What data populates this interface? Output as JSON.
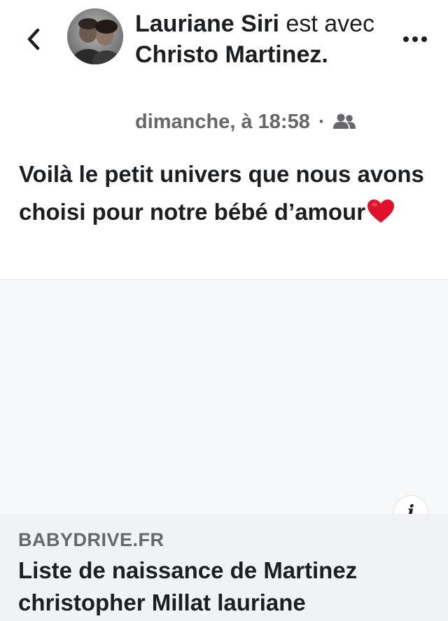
{
  "header": {
    "author_name": "Lauriane Siri",
    "connector_text": " est avec ",
    "tagged_name": "Christo Martinez.",
    "timestamp": "dimanche, à 18:58",
    "separator": "·",
    "audience_icon": "friends-icon",
    "back_icon": "chevron-left-icon",
    "more_icon": "more-horizontal-icon"
  },
  "post": {
    "text": "Voilà le petit univers que nous avons choisi pour notre bébé d’amour",
    "emoji": "red-heart"
  },
  "link_preview": {
    "domain": "BABYDRIVE.FR",
    "title": "Liste de naissance de Martinez christopher Millat lauriane",
    "info_label": "i"
  },
  "colors": {
    "text_primary": "#1c1e21",
    "text_secondary": "#65676b",
    "link_info_background": "#f0f2f5",
    "heart": "#e0112b"
  }
}
